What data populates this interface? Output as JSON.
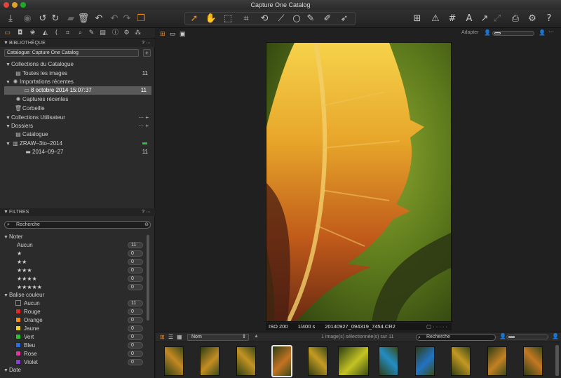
{
  "window": {
    "title": "Capture One Catalog"
  },
  "viewer": {
    "fit_label": "Adapter"
  },
  "library": {
    "header": "BIBLIOTHÈQUE",
    "header_actions": "? ···",
    "catalog_select": "Catalogue: Capture One Catalog",
    "sections": {
      "catalog_collections": "Collections du Catalogue",
      "all_images": "Toutes les images",
      "all_images_count": "11",
      "recent_imports": "Importations récentes",
      "import_item": "8 octobre 2014 15:07:37",
      "import_item_count": "11",
      "recent_captures": "Captures récentes",
      "trash": "Corbeille",
      "user_collections": "Collections Utilisateur",
      "folders": "Dossiers",
      "catalogue": "Catalogue",
      "zraw": "ZRAW–3to–2014",
      "subfolder": "2014–09–27",
      "subfolder_count": "11"
    }
  },
  "filters": {
    "header": "FILTRES",
    "header_actions": "? ···",
    "search_placeholder": "Recherche",
    "rating_heading": "Noter",
    "ratings": [
      {
        "label": "Aucun",
        "count": "11"
      },
      {
        "label": "★",
        "count": "0"
      },
      {
        "label": "★★",
        "count": "0"
      },
      {
        "label": "★★★",
        "count": "0"
      },
      {
        "label": "★★★★",
        "count": "0"
      },
      {
        "label": "★★★★★",
        "count": "0"
      }
    ],
    "color_heading": "Balise couleur",
    "colors": [
      {
        "label": "Aucun",
        "count": "11",
        "color": "#2b2b2b"
      },
      {
        "label": "Rouge",
        "count": "0",
        "color": "#e3261f"
      },
      {
        "label": "Orange",
        "count": "0",
        "color": "#f08c1a"
      },
      {
        "label": "Jaune",
        "count": "0",
        "color": "#f2d31b"
      },
      {
        "label": "Vert",
        "count": "0",
        "color": "#2fc02f"
      },
      {
        "label": "Bleu",
        "count": "0",
        "color": "#2a6de0"
      },
      {
        "label": "Rose",
        "count": "0",
        "color": "#e0389a"
      },
      {
        "label": "Violet",
        "count": "0",
        "color": "#8a3fd0"
      }
    ],
    "date_heading": "Date"
  },
  "photo_info": {
    "iso": "ISO 200",
    "shutter": "1/400 s",
    "filename": "20140927_094319_7454.CR2"
  },
  "browser": {
    "sort_label": "Nom",
    "selection_info": "1 image(s) sélectionnée(s) sur 11",
    "search_placeholder": "Recherche"
  },
  "colors": {
    "accent": "#f08a1e",
    "panel": "#2b2b2b",
    "background": "#1e1e1e"
  }
}
